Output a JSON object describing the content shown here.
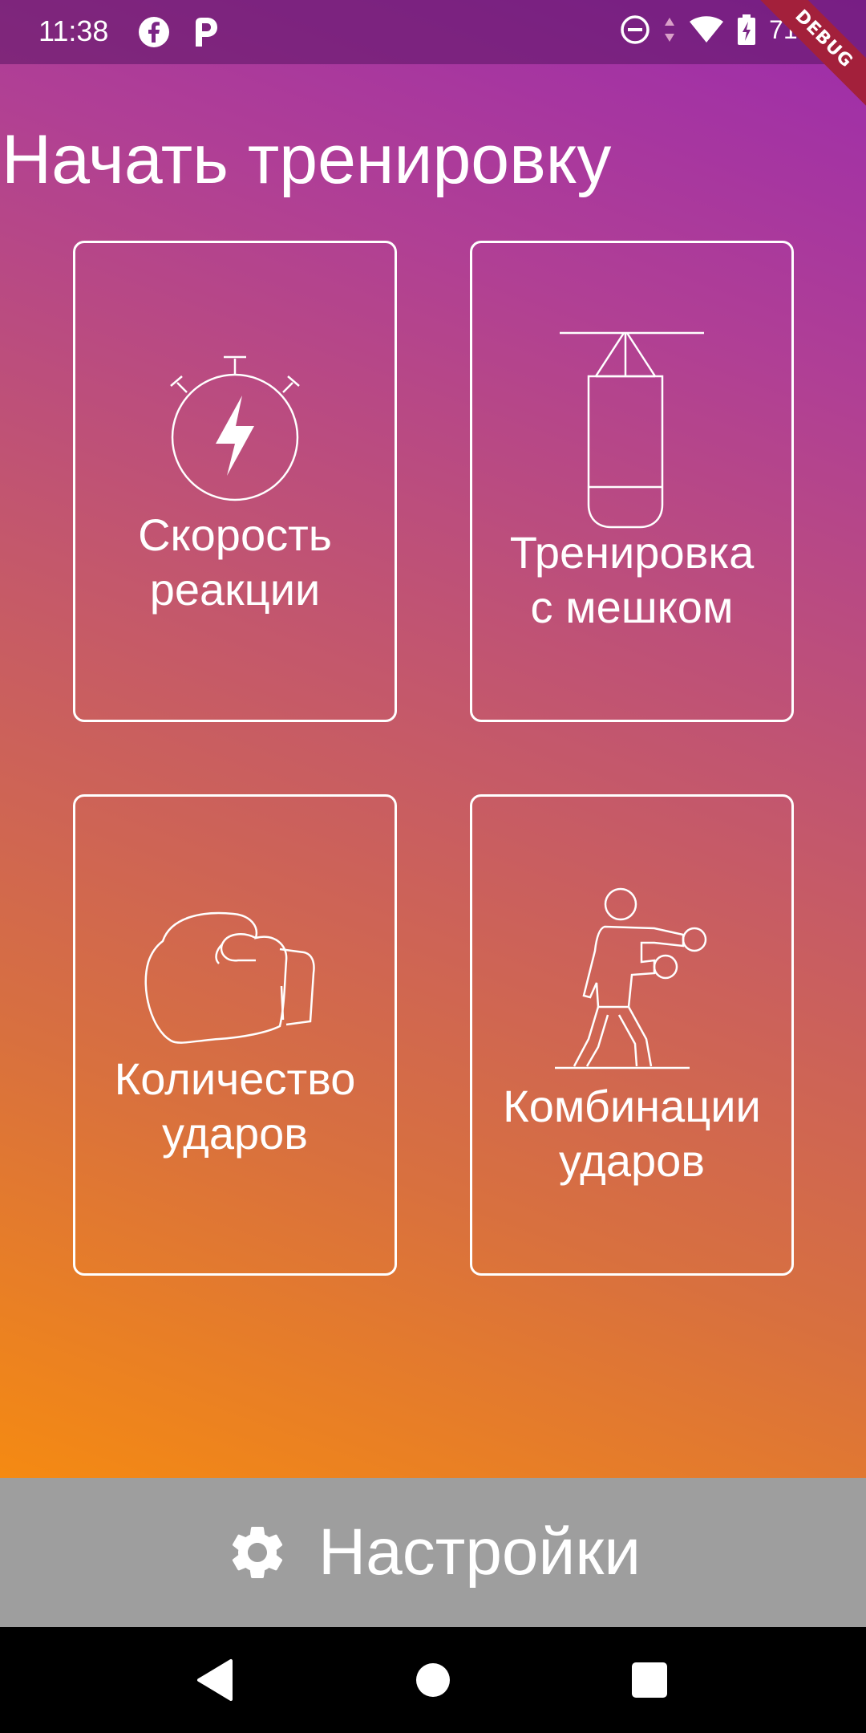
{
  "status_bar": {
    "time": "11:38",
    "left_icons": [
      "facebook-icon",
      "p-app-icon"
    ],
    "right_icons": [
      "do-not-disturb-icon",
      "data-arrows-icon",
      "wifi-icon",
      "battery-charging-icon"
    ],
    "battery": "71 %"
  },
  "debug_banner": "DEBUG",
  "title": "Начать тренировку",
  "tiles": [
    {
      "icon": "stopwatch-lightning-icon",
      "label_line1": "Скорость",
      "label_line2": "реакции"
    },
    {
      "icon": "punching-bag-icon",
      "label_line1": "Тренировка",
      "label_line2": "с мешком"
    },
    {
      "icon": "boxing-glove-icon",
      "label_line1": "Количество",
      "label_line2": "ударов"
    },
    {
      "icon": "boxer-icon",
      "label_line1": "Комбинации",
      "label_line2": "ударов"
    }
  ],
  "settings": {
    "icon": "gear-icon",
    "label": "Настройки"
  },
  "nav": {
    "buttons": [
      "back-icon",
      "home-icon",
      "recents-icon"
    ]
  },
  "colors": {
    "gradient_top": "#9c2cac",
    "gradient_bottom": "#f58a12",
    "settings_bar": "#9e9e9e",
    "debug_banner": "#a3203b"
  }
}
